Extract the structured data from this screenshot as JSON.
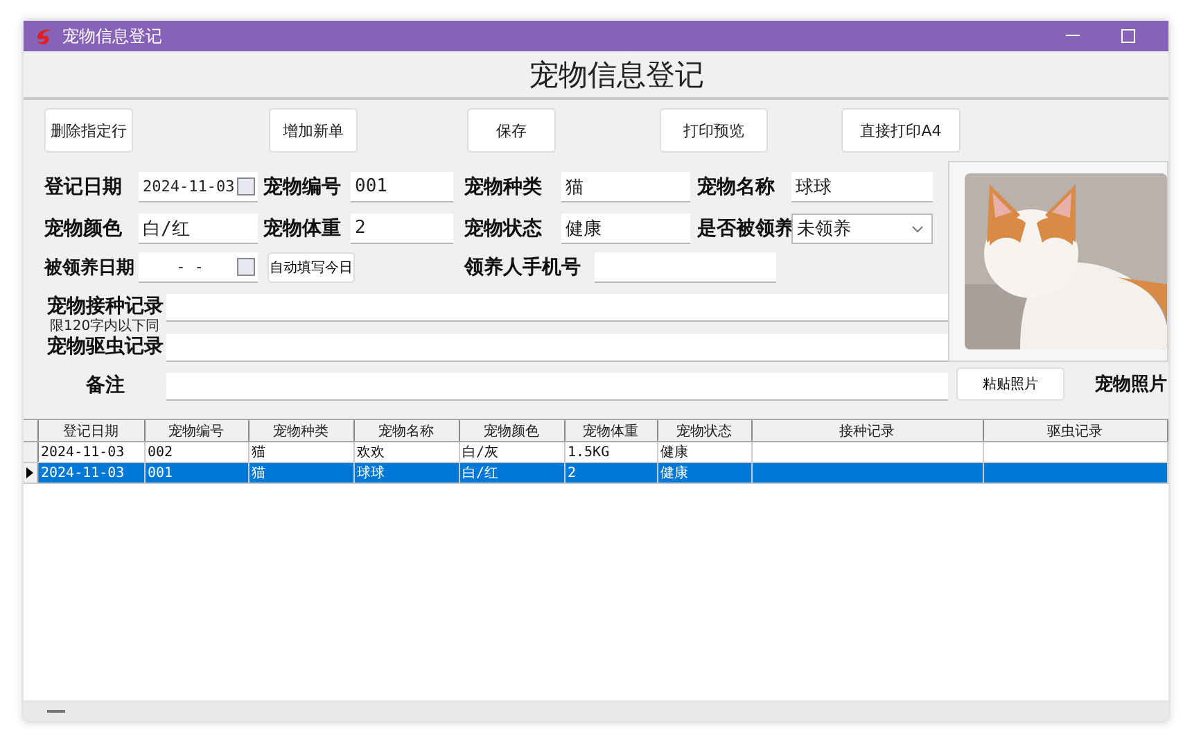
{
  "window": {
    "title": "宠物信息登记"
  },
  "heading": "宠物信息登记",
  "toolbar": [
    "删除指定行",
    "增加新单",
    "保存",
    "打印预览",
    "直接打印A4"
  ],
  "fields": [
    {
      "label": "登记日期",
      "value": "2024-11-03",
      "kind": "date"
    },
    {
      "label": "宠物编号",
      "value": "001",
      "kind": "text"
    },
    {
      "label": "宠物种类",
      "value": "猫",
      "kind": "text"
    },
    {
      "label": "宠物名称",
      "value": "球球",
      "kind": "text"
    },
    {
      "label": "宠物颜色",
      "value": "白/红",
      "kind": "text"
    },
    {
      "label": "宠物体重",
      "value": "2",
      "kind": "text"
    },
    {
      "label": "宠物状态",
      "value": "健康",
      "kind": "text"
    },
    {
      "label": "是否被领养",
      "value": "未领养",
      "kind": "select"
    }
  ],
  "adoption_date": {
    "label": "被领养日期",
    "value": "-  -"
  },
  "auto_fill_button": "自动填写今日",
  "phone": {
    "label": "领养人手机号"
  },
  "records": [
    {
      "label": "宠物接种记录",
      "note": "限120字内以下同"
    },
    {
      "label": "宠物驱虫记录"
    },
    {
      "label": "备注"
    }
  ],
  "photo": {
    "kind": "picture",
    "paste_button": "粘贴照片",
    "label": "宠物照片"
  },
  "table": {
    "columns": [
      "登记日期",
      "宠物编号",
      "宠物种类",
      "宠物名称",
      "宠物颜色",
      "宠物体重",
      "宠物状态",
      "接种记录",
      "驱虫记录"
    ],
    "rows": [
      {
        "selected": false,
        "cells": [
          "2024-11-03",
          "002",
          "猫",
          "欢欢",
          "白/灰",
          "1.5KG",
          "健康",
          "",
          ""
        ]
      },
      {
        "selected": true,
        "cells": [
          "2024-11-03",
          "001",
          "猫",
          "球球",
          "白/红",
          "2",
          "健康",
          "",
          ""
        ]
      }
    ]
  }
}
